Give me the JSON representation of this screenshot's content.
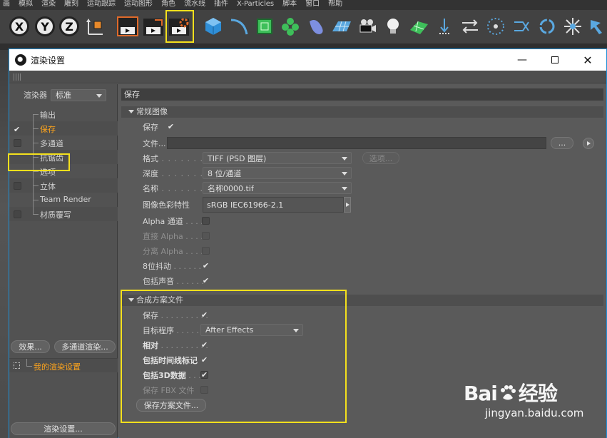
{
  "menubar": [
    "画",
    "模拟",
    "渲染",
    "雕刻",
    "运动跟踪",
    "运动图形",
    "角色",
    "流水线",
    "插件",
    "X-Particles",
    "脚本",
    "窗口",
    "帮助"
  ],
  "toolbar": {
    "axis_x": "X",
    "axis_y": "Y",
    "axis_z": "Z",
    "icons": [
      "coordinate-system-icon",
      "render-view-icon",
      "render-to-picture-viewer-icon",
      "render-settings-icon",
      "cube-icon",
      "spline-pen-icon",
      "subdivision-icon",
      "cloner-icon",
      "deformer-icon",
      "floor-icon",
      "camera-icon",
      "light-icon",
      "grid-plane-icon",
      "gravity-icon",
      "exchange-icon",
      "explode-icon",
      "shuffle-icon",
      "loop-icon",
      "scale-icon",
      "drag-icon"
    ]
  },
  "dialog": {
    "title": "渲染设置",
    "renderer_label": "渲染器",
    "renderer_value": "标准",
    "tree": [
      {
        "label": "输出",
        "checked": false,
        "has_checkbox": false,
        "active": false
      },
      {
        "label": "保存",
        "checked": true,
        "has_checkbox": true,
        "active": true
      },
      {
        "label": "多通道",
        "checked": false,
        "has_checkbox": true,
        "active": false
      },
      {
        "label": "抗锯齿",
        "checked": false,
        "has_checkbox": false,
        "active": false
      },
      {
        "label": "选项",
        "checked": false,
        "has_checkbox": false,
        "active": false
      },
      {
        "label": "立体",
        "checked": false,
        "has_checkbox": true,
        "active": false
      },
      {
        "label": "Team Render",
        "checked": false,
        "has_checkbox": false,
        "active": false
      },
      {
        "label": "材质覆写",
        "checked": false,
        "has_checkbox": true,
        "active": false
      }
    ],
    "effects_button": "效果...",
    "multipass_button": "多通道渲染...",
    "my_settings": "我的渲染设置",
    "render_settings_button": "渲染设置...",
    "tab_title": "保存",
    "regular_image": {
      "header": "常规图像",
      "save_label": "保存",
      "save_checked": true,
      "file_label": "文件...",
      "file_value": "",
      "browse_button": "...",
      "format_label": "格式",
      "format_value": "TIFF (PSD 图层)",
      "options_button": "选项...",
      "depth_label": "深度",
      "depth_value": "8 位/通道",
      "name_label": "名称",
      "name_value": "名称0000.tif",
      "color_profile_label": "图像色彩特性",
      "color_profile_value": "sRGB IEC61966-2.1",
      "alpha_label": "Alpha 通道",
      "straight_alpha_label": "直接 Alpha",
      "separate_alpha_label": "分离 Alpha",
      "dither_label": "8位抖动",
      "dither_checked": true,
      "sound_label": "包括声音",
      "sound_checked": true
    },
    "compositing": {
      "header": "合成方案文件",
      "save_label": "保存",
      "save_checked": true,
      "target_label": "目标程序",
      "target_value": "After Effects",
      "relative_label": "相对",
      "relative_checked": true,
      "timeline_label": "包括时间线标记",
      "timeline_checked": true,
      "data3d_label": "包括3D数据",
      "data3d_checked": true,
      "fbx_label": "保存 FBX 文件",
      "save_project_button": "保存方案文件..."
    }
  },
  "watermark": {
    "brand_left": "Bai",
    "brand_right": "经验",
    "url": "jingyan.baidu.com"
  },
  "colors": {
    "highlight": "#f4e01c",
    "active_text": "#ffa51c",
    "dialog_border": "#1e90d8"
  }
}
